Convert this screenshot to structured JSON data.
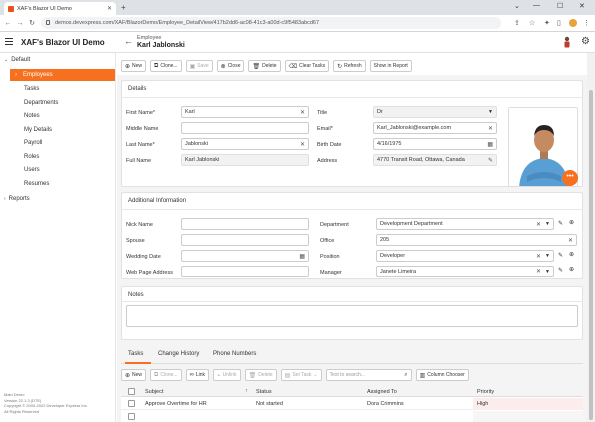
{
  "browser": {
    "tab_title": "XAF's Blazor UI Demo",
    "url": "demos.devexpress.com/XAF/BlazorDemo/Employee_DetailView/417b2dd6-ac08-41c3-a00d-c9f5483abcd67"
  },
  "app": {
    "title": "XAF's Blazor UI Demo",
    "view_caption": "Employee",
    "object_caption": "Karl Jablonski"
  },
  "nav": {
    "group_default": "Default",
    "items": [
      "Employees",
      "Tasks",
      "Departments",
      "Notes",
      "My Details",
      "Payroll",
      "Roles",
      "Users",
      "Resumes"
    ],
    "group_reports": "Reports"
  },
  "footer": {
    "line1": "Main Demo",
    "line2": "Version 22.1.3 (DTE)",
    "line3": "Copyright © 2000-2022 Developer Express Inc.",
    "line4": "All Rights Reserved"
  },
  "toolbar": {
    "new": "New",
    "clone": "Clone...",
    "save": "Save",
    "close": "Close",
    "delete": "Delete",
    "clear_tasks": "Clear Tasks",
    "refresh": "Refresh",
    "show_in_report": "Show in Report"
  },
  "details": {
    "header": "Details",
    "first_name_label": "First Name*",
    "first_name": "Karl",
    "middle_name_label": "Middle Name",
    "middle_name": "",
    "last_name_label": "Last Name*",
    "last_name": "Jablonski",
    "full_name_label": "Full Name",
    "full_name": "Karl Jablonski",
    "title_label": "Title",
    "title": "Dr",
    "email_label": "Email*",
    "email": "Karl_Jablonski@example.com",
    "birth_date_label": "Birth Date",
    "birth_date": "4/16/1975",
    "address_label": "Address",
    "address": "4770 Transit Road, Ottawa, Canada"
  },
  "additional": {
    "header": "Additional Information",
    "nick_name_label": "Nick Name",
    "nick_name": "",
    "spouse_label": "Spouse",
    "spouse": "",
    "wedding_date_label": "Wedding Date",
    "wedding_date": "",
    "web_page_label": "Web Page Address",
    "web_page": "",
    "department_label": "Department",
    "department": "Development Department",
    "office_label": "Office",
    "office": "205",
    "position_label": "Position",
    "position": "Developer",
    "manager_label": "Manager",
    "manager": "Janete Limeira"
  },
  "notes": {
    "header": "Notes"
  },
  "tabs": [
    "Tasks",
    "Change History",
    "Phone Numbers"
  ],
  "grid_toolbar": {
    "new": "New",
    "clone": "Clone...",
    "link": "Link",
    "unlink": "Unlink",
    "delete": "Delete",
    "set_task": "Set Task",
    "search_placeholder": "Text to search...",
    "column_chooser": "Column Chooser"
  },
  "grid": {
    "columns": [
      "Subject",
      "Status",
      "Assigned To",
      "Priority"
    ],
    "rows": [
      {
        "subject": "Approve Overtime for HR",
        "status": "Not started",
        "assigned_to": "Dora Crimmins",
        "priority": "High"
      }
    ]
  },
  "colors": {
    "accent": "#f7701f"
  }
}
